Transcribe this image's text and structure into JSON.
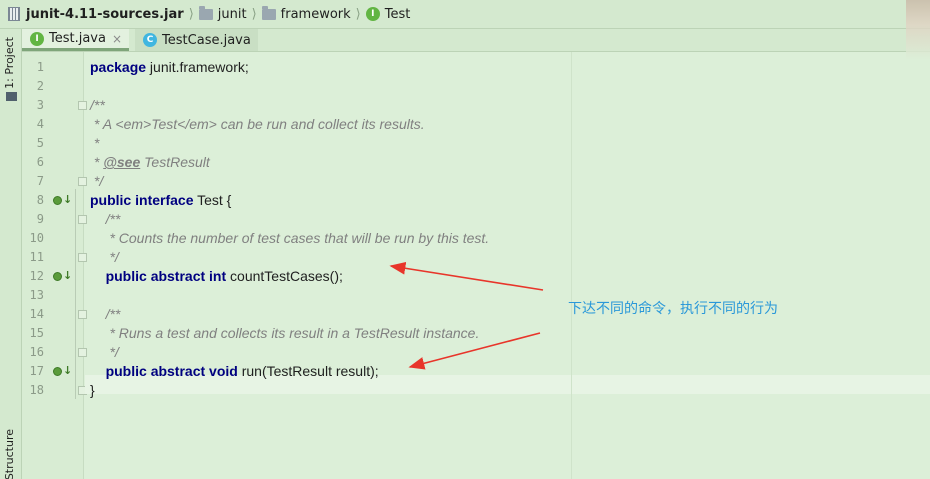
{
  "breadcrumb": {
    "items": [
      {
        "label": "junit-4.11-sources.jar",
        "icon": "jar-icon"
      },
      {
        "label": "junit",
        "icon": "folder-icon"
      },
      {
        "label": "framework",
        "icon": "folder-icon"
      },
      {
        "label": "Test",
        "icon": "interface-icon"
      }
    ],
    "separator": "⟩"
  },
  "toolwindows": {
    "project_label": "1: Project",
    "structure_label": "Structure"
  },
  "tabs": [
    {
      "label": "Test.java",
      "icon_letter": "I",
      "close": "×",
      "active": true
    },
    {
      "label": "TestCase.java",
      "icon_letter": "C",
      "close": "",
      "active": false
    }
  ],
  "editor": {
    "line_numbers": [
      "1",
      "2",
      "3",
      "4",
      "5",
      "6",
      "7",
      "8",
      "9",
      "10",
      "11",
      "12",
      "13",
      "14",
      "15",
      "16",
      "17",
      "18"
    ],
    "lines": [
      {
        "indent": "",
        "parts": [
          {
            "t": "package",
            "c": "kw"
          },
          {
            "t": " junit.framework;",
            "c": ""
          }
        ]
      },
      {
        "indent": "",
        "parts": []
      },
      {
        "indent": "",
        "parts": [
          {
            "t": "/**",
            "c": "cm"
          }
        ]
      },
      {
        "indent": "",
        "parts": [
          {
            "t": " * A <em>Test</em> can be run and collect its results.",
            "c": "cm"
          }
        ]
      },
      {
        "indent": "",
        "parts": [
          {
            "t": " *",
            "c": "cm"
          }
        ]
      },
      {
        "indent": "",
        "parts": [
          {
            "t": " * ",
            "c": "cm"
          },
          {
            "t": "@see",
            "c": "cm-tag"
          },
          {
            "t": " TestResult",
            "c": "cm"
          }
        ]
      },
      {
        "indent": "",
        "parts": [
          {
            "t": " */",
            "c": "cm"
          }
        ]
      },
      {
        "indent": "",
        "parts": [
          {
            "t": "public",
            "c": "kw"
          },
          {
            "t": " ",
            "c": ""
          },
          {
            "t": "interface",
            "c": "kw"
          },
          {
            "t": " Test {",
            "c": ""
          }
        ]
      },
      {
        "indent": "    ",
        "parts": [
          {
            "t": "/**",
            "c": "cm"
          }
        ]
      },
      {
        "indent": "    ",
        "parts": [
          {
            "t": " * Counts the number of test cases that will be run by this test.",
            "c": "cm"
          }
        ]
      },
      {
        "indent": "    ",
        "parts": [
          {
            "t": " */",
            "c": "cm"
          }
        ]
      },
      {
        "indent": "    ",
        "parts": [
          {
            "t": "public",
            "c": "kw"
          },
          {
            "t": " ",
            "c": ""
          },
          {
            "t": "abstract",
            "c": "kw"
          },
          {
            "t": " ",
            "c": ""
          },
          {
            "t": "int",
            "c": "kw"
          },
          {
            "t": " countTestCases();",
            "c": ""
          }
        ]
      },
      {
        "indent": "",
        "parts": []
      },
      {
        "indent": "    ",
        "parts": [
          {
            "t": "/**",
            "c": "cm"
          }
        ]
      },
      {
        "indent": "    ",
        "parts": [
          {
            "t": " * Runs a test and collects its result in a TestResult instance.",
            "c": "cm"
          }
        ]
      },
      {
        "indent": "    ",
        "parts": [
          {
            "t": " */",
            "c": "cm"
          }
        ]
      },
      {
        "indent": "    ",
        "parts": [
          {
            "t": "public",
            "c": "kw"
          },
          {
            "t": " ",
            "c": ""
          },
          {
            "t": "abstract",
            "c": "kw"
          },
          {
            "t": " ",
            "c": ""
          },
          {
            "t": "void",
            "c": "kw"
          },
          {
            "t": " run(TestResult result);",
            "c": ""
          }
        ]
      },
      {
        "indent": "",
        "parts": [
          {
            "t": "}",
            "c": ""
          }
        ]
      }
    ],
    "fold_markers_on_lines": [
      3,
      7,
      9,
      11,
      14,
      16,
      18
    ],
    "gutter_markers": [
      {
        "line": 8,
        "icon": "implemented-down-icon"
      },
      {
        "line": 12,
        "icon": "implemented-down-icon"
      },
      {
        "line": 17,
        "icon": "implemented-down-icon"
      }
    ],
    "current_line": 18
  },
  "annotation": {
    "text": "下达不同的命令，执行不同的行为",
    "color": "#2a98d9",
    "arrow_color": "#e8352a"
  }
}
